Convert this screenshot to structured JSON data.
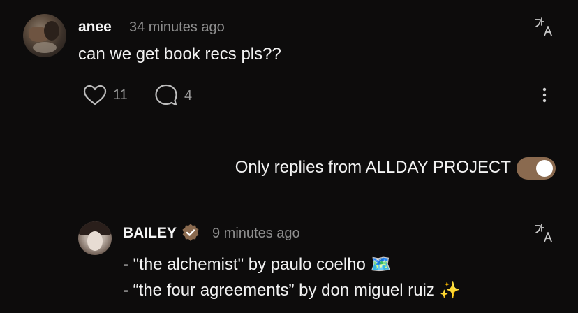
{
  "post": {
    "username": "anee",
    "timestamp": "34 minutes ago",
    "text": "can we get book recs pls??",
    "likes": "11",
    "replies": "4"
  },
  "filter": {
    "label": "Only replies from ALLDAY PROJECT",
    "enabled": true
  },
  "reply": {
    "username": "BAILEY",
    "timestamp": "9 minutes ago",
    "line1": "- \"the alchemist\" by paulo coelho 🗺️",
    "line2": "- “the four agreements” by don miguel ruiz ✨"
  },
  "colors": {
    "background": "#0d0c0c",
    "accent": "#8a6a4f",
    "muted": "#8e8e8e"
  },
  "icons": [
    "translate-icon",
    "heart-icon",
    "comment-icon",
    "more-vertical-icon",
    "verified-badge-icon"
  ]
}
